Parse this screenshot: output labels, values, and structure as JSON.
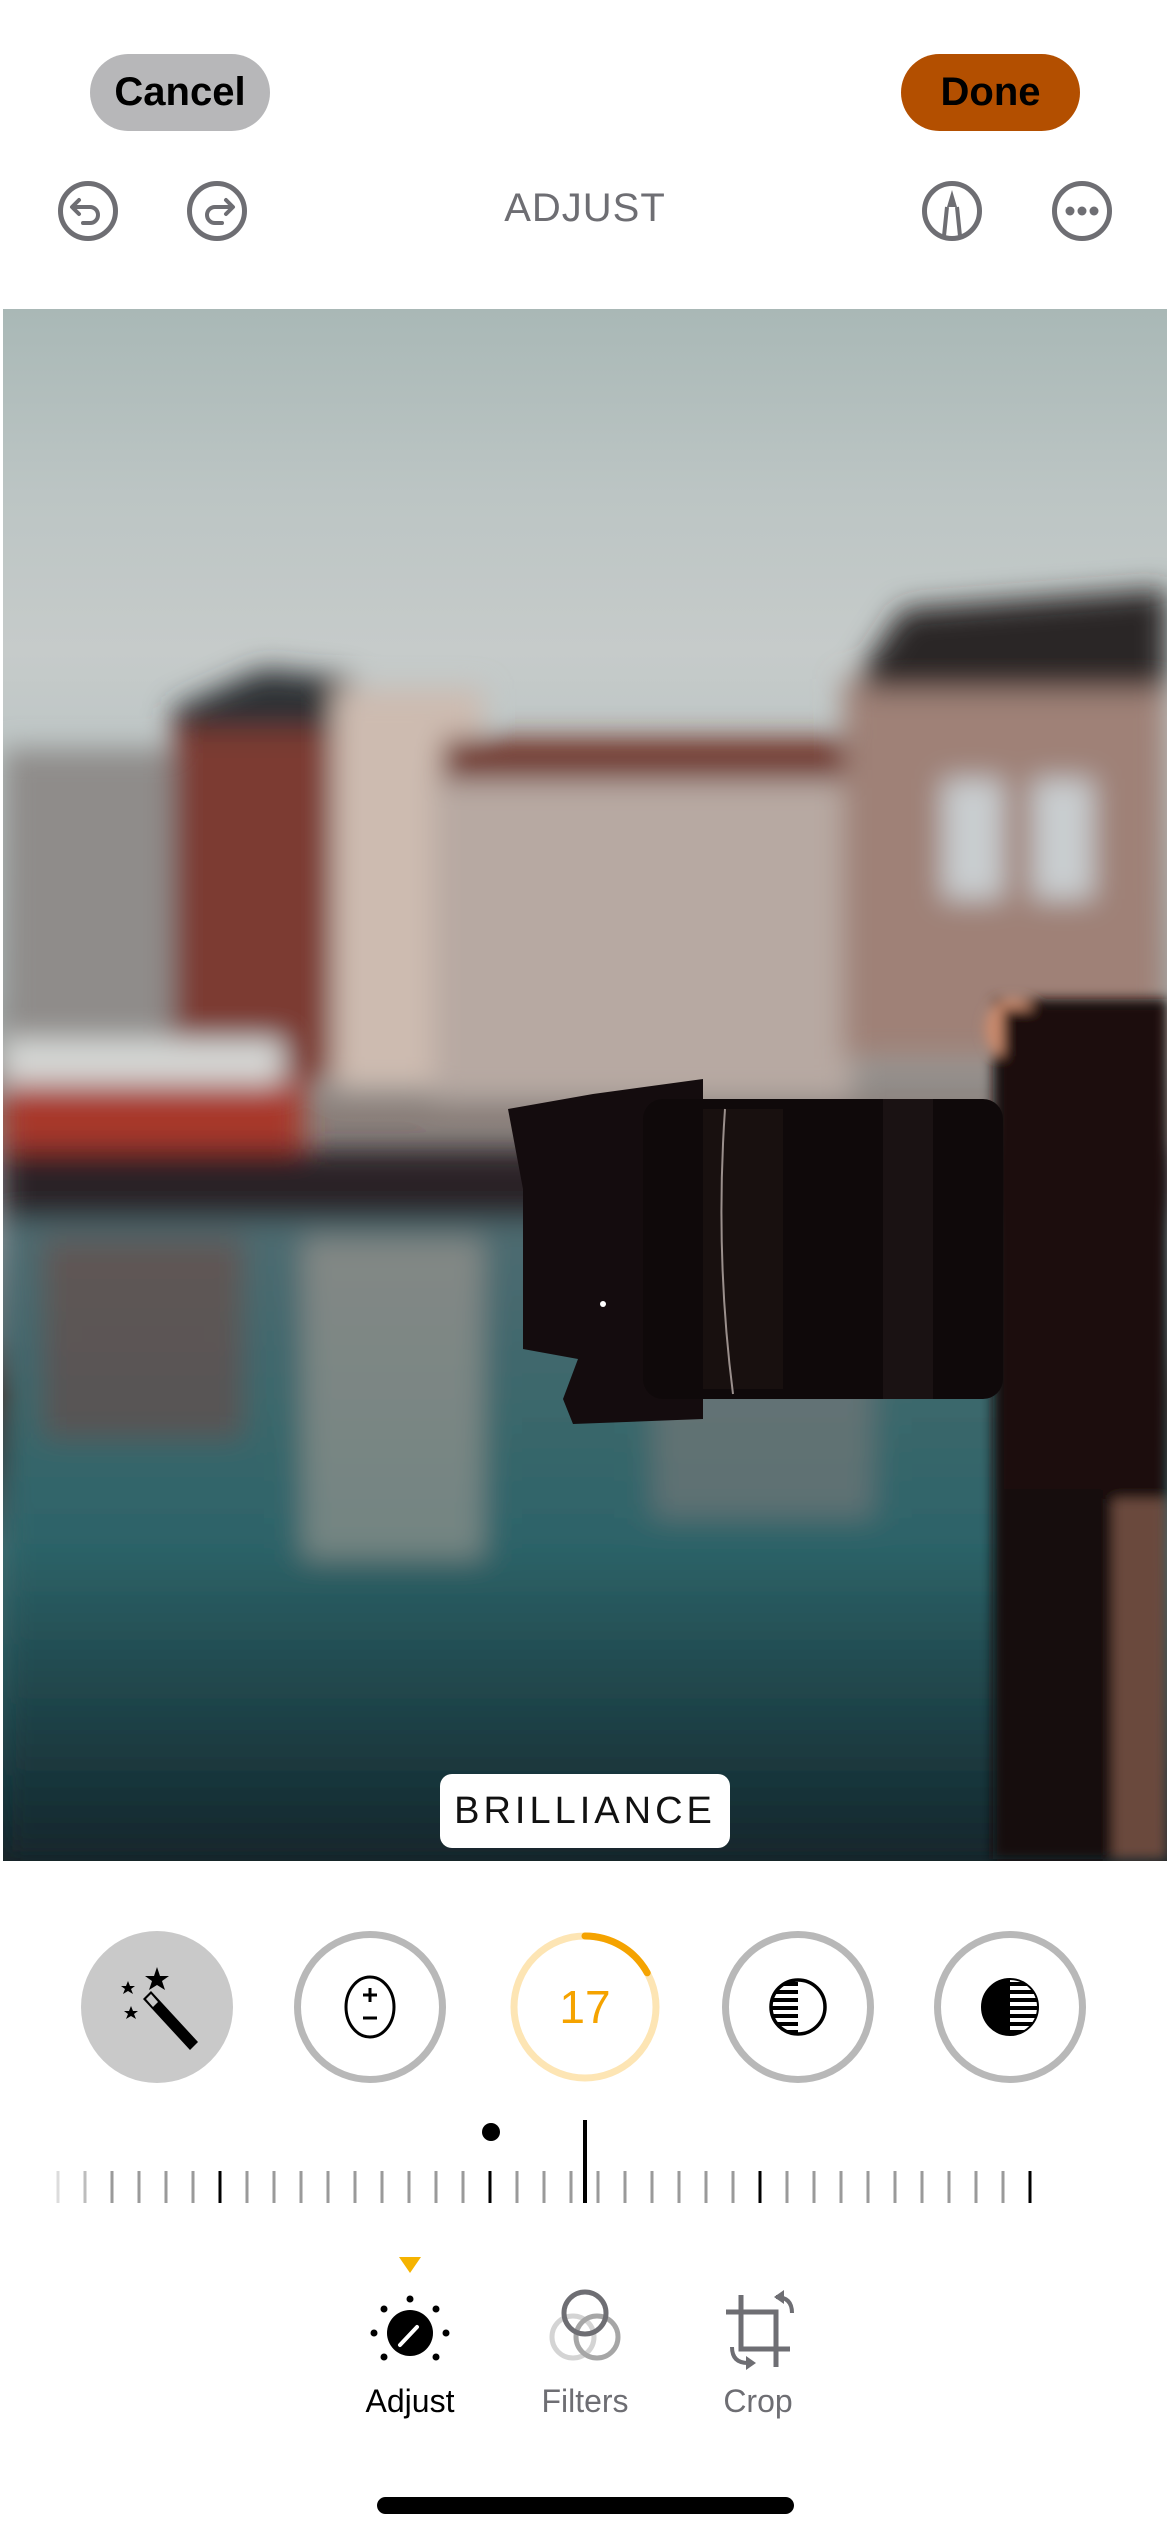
{
  "header": {
    "cancel_label": "Cancel",
    "done_label": "Done",
    "title": "ADJUST",
    "icons": [
      "undo-icon",
      "redo-icon",
      "markup-icon",
      "more-icon"
    ]
  },
  "photo": {
    "description": "Blurred canal-side buildings with a camera lens in the foreground",
    "overlay_label": "BRILLIANCE"
  },
  "tools": {
    "items": [
      {
        "name": "auto-enhance",
        "icon": "magic-wand-icon",
        "selected": false
      },
      {
        "name": "exposure",
        "icon": "exposure-icon",
        "selected": false
      },
      {
        "name": "brilliance",
        "icon": "value-ring",
        "selected": true,
        "value": "17"
      },
      {
        "name": "highlights",
        "icon": "highlights-icon",
        "selected": false
      },
      {
        "name": "shadows",
        "icon": "shadows-icon",
        "selected": false
      }
    ],
    "active_value": 17,
    "active_value_fraction": 0.17
  },
  "slider": {
    "value": 17,
    "zero_marker": true
  },
  "tabs": [
    {
      "label": "Adjust",
      "icon": "adjust-dial-icon",
      "active": true
    },
    {
      "label": "Filters",
      "icon": "filters-icon",
      "active": false
    },
    {
      "label": "Crop",
      "icon": "crop-rotate-icon",
      "active": false
    }
  ],
  "colors": {
    "accent": "#f5a300",
    "accent_light": "#fde5b4",
    "done_button": "#b34f00",
    "cancel_button": "#b7b7b9",
    "icon_gray": "#6e6e73"
  }
}
